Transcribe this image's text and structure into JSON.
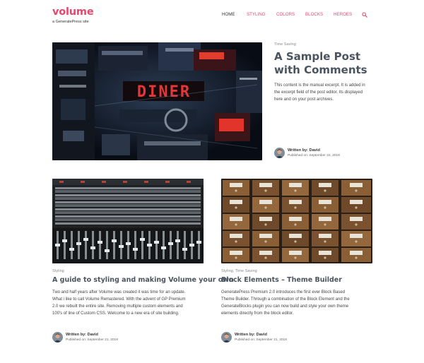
{
  "site": {
    "title": "volume",
    "tagline": "a GeneratePress site"
  },
  "nav": {
    "items": [
      {
        "label": "HOME"
      },
      {
        "label": "STYLING"
      },
      {
        "label": "COLORS"
      },
      {
        "label": "BLOCKS"
      },
      {
        "label": "HEROES"
      }
    ],
    "search_icon": "search-icon"
  },
  "colors": {
    "accent": "#e8466f",
    "title": "#4a5560",
    "meta": "#8c8c8c"
  },
  "featured_post": {
    "category": "Time Saving",
    "title_line1": "A Sample Post",
    "title_line2": "with Comments",
    "excerpt_lines": [
      "This content is the manual excerpt. It is added in",
      "the excerpt field of the post editor. Its displayed",
      "here and on your post archives."
    ],
    "author_label": "Written by: David",
    "date": "Published on: September 22, 2018"
  },
  "posts": [
    {
      "category": "Styling",
      "title": "A guide to styling and making Volume your own",
      "excerpt_lines": [
        "Two and half years after Volume was created it was time for an update.",
        "What i like to call Volume Remastered. With the advent of GP Premium",
        "2.0 we rebuilt the entire site. Removing multiple custom elements and",
        "100's of line of Custom CSS. Welcome to a new era of site building."
      ],
      "author_label": "Written by: David",
      "date": "Published on: September 21, 2018"
    },
    {
      "category": "Styling, Time Saving",
      "title": "Block Elements – Theme Builder",
      "excerpt_lines": [
        "GeneratePress Premium 2.0 introduces the first ever Block Based",
        "Theme Builder. Through a combination of the Block Element and the",
        "GenerateBlocks plugin you can now build and style your own theme",
        "elements directly from the block editor."
      ],
      "author_label": "Written by: David",
      "date": "Published on: September 21, 2018"
    }
  ]
}
